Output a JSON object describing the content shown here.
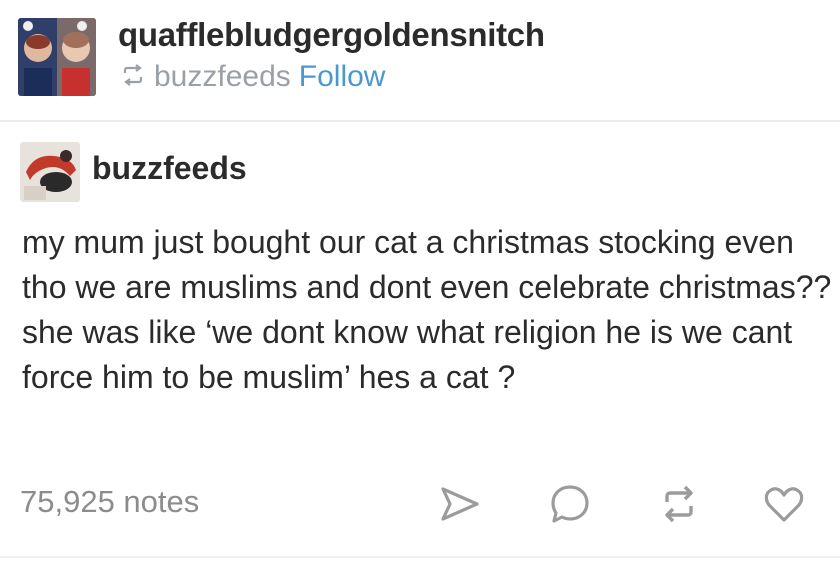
{
  "reblogger": {
    "username": "quafflebludgergoldensnitch",
    "reblogged_from": "buzzfeeds",
    "follow_label": "Follow"
  },
  "post": {
    "author": "buzzfeeds",
    "body": "my mum just bought our cat a christmas stocking even tho we are muslims and dont even celebrate christmas?? she was like ‘we dont know what religion he is we cant force him to be muslim’ hes a cat ?"
  },
  "footer": {
    "notes": "75,925 notes",
    "icons": [
      "share-icon",
      "reply-icon",
      "reblog-icon",
      "like-icon"
    ]
  },
  "colors": {
    "text": "#2b2b2b",
    "muted": "#9aa0a6",
    "follow": "#4a98d3",
    "icon": "#9b9b9b"
  }
}
